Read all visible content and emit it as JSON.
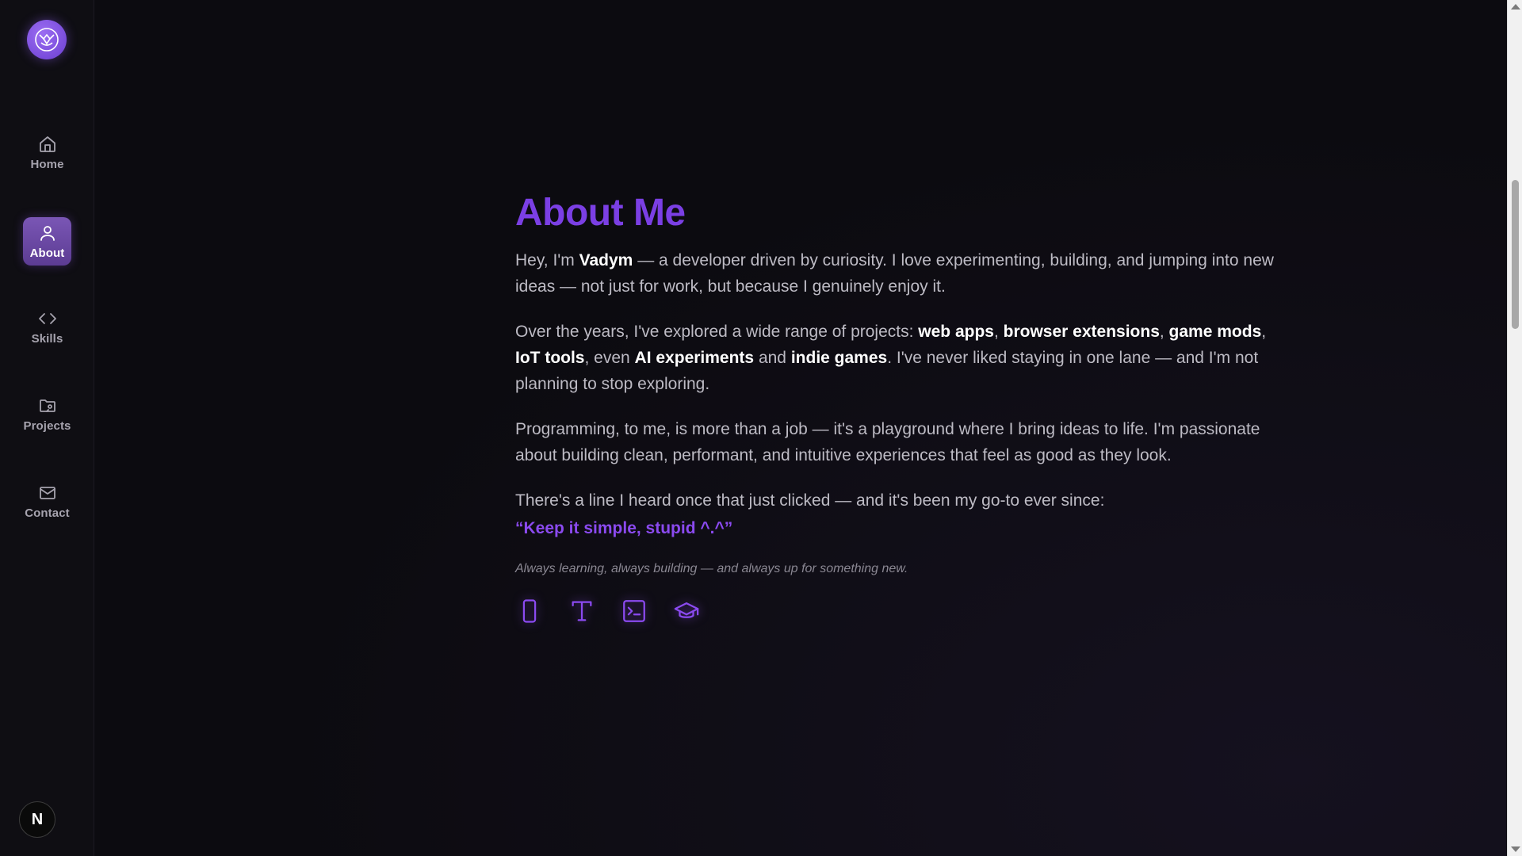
{
  "nav": {
    "items": [
      {
        "label": "Home",
        "icon": "home-icon"
      },
      {
        "label": "About",
        "icon": "user-icon",
        "active": true
      },
      {
        "label": "Skills",
        "icon": "code-icon"
      },
      {
        "label": "Projects",
        "icon": "folder-icon"
      },
      {
        "label": "Contact",
        "icon": "mail-icon"
      }
    ],
    "avatar_letter": "N"
  },
  "about": {
    "title": "About Me",
    "p1": {
      "t1": "Hey, I'm ",
      "b1": "Vadym",
      "t2": " — a developer driven by curiosity. I love experimenting, building, and jumping into new ideas — not just for work, but because I genuinely enjoy it."
    },
    "p2": {
      "t1": "Over the years, I've explored a wide range of projects: ",
      "b1": "web apps",
      "s1": ", ",
      "b2": "browser extensions",
      "s2": ", ",
      "b3": "game mods",
      "s3": ", ",
      "b4": "IoT tools",
      "s4": ", even ",
      "b5": "AI experiments",
      "s5": " and ",
      "b6": "indie games",
      "t2": ". I've never liked staying in one lane — and I'm not planning to stop exploring."
    },
    "p3": "Programming, to me, is more than a job — it's a playground where I bring ideas to life. I'm passionate about building clean, performant, and intuitive experiences that feel as good as they look.",
    "p4": "There's a line I heard once that just clicked — and it's been my go-to ever since:",
    "quote": "“Keep it simple, stupid ^.^”",
    "tagline": "Always learning, always building — and always up for something new.",
    "icons": [
      "smartphone-icon",
      "type-icon",
      "terminal-icon",
      "graduation-cap-icon"
    ]
  },
  "colors": {
    "accent": "#7b3fe4",
    "background": "#0c0b10",
    "sidebar": "#0f0e13",
    "active_nav": "#6a47a6"
  }
}
